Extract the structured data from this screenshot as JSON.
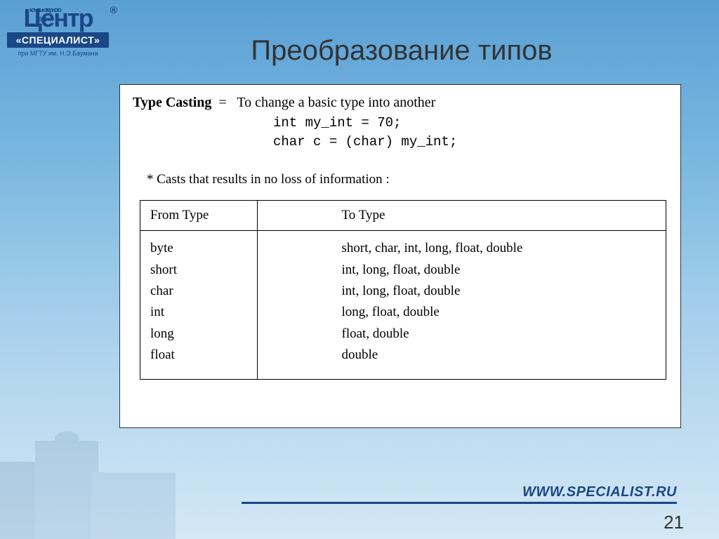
{
  "logo": {
    "word": "Центр",
    "small1": "компьютерного",
    "small2": "обучения",
    "reg": "®",
    "specialist": "«СПЕЦИАЛИСТ»",
    "sub": "при МГТУ им. Н.Э.Баумана"
  },
  "title": "Преобразование типов",
  "definition": {
    "term": "Type Casting",
    "eq": "=",
    "desc": "To change a basic type into another"
  },
  "code": {
    "line1": "int my_int = 70;",
    "line2": "char c = (char) my_int;"
  },
  "note": "* Casts that results in no loss of information :",
  "table": {
    "head_from": "From Type",
    "head_to": "To Type",
    "rows": [
      {
        "from": "byte",
        "to": "short, char, int, long, float, double"
      },
      {
        "from": "short",
        "to": "int, long, float, double"
      },
      {
        "from": "char",
        "to": "int, long, float, double"
      },
      {
        "from": "int",
        "to": "long, float, double"
      },
      {
        "from": "long",
        "to": "float, double"
      },
      {
        "from": "float",
        "to": "double"
      }
    ]
  },
  "footer_url": "WWW.SPECIALIST.RU",
  "page_number": "21"
}
